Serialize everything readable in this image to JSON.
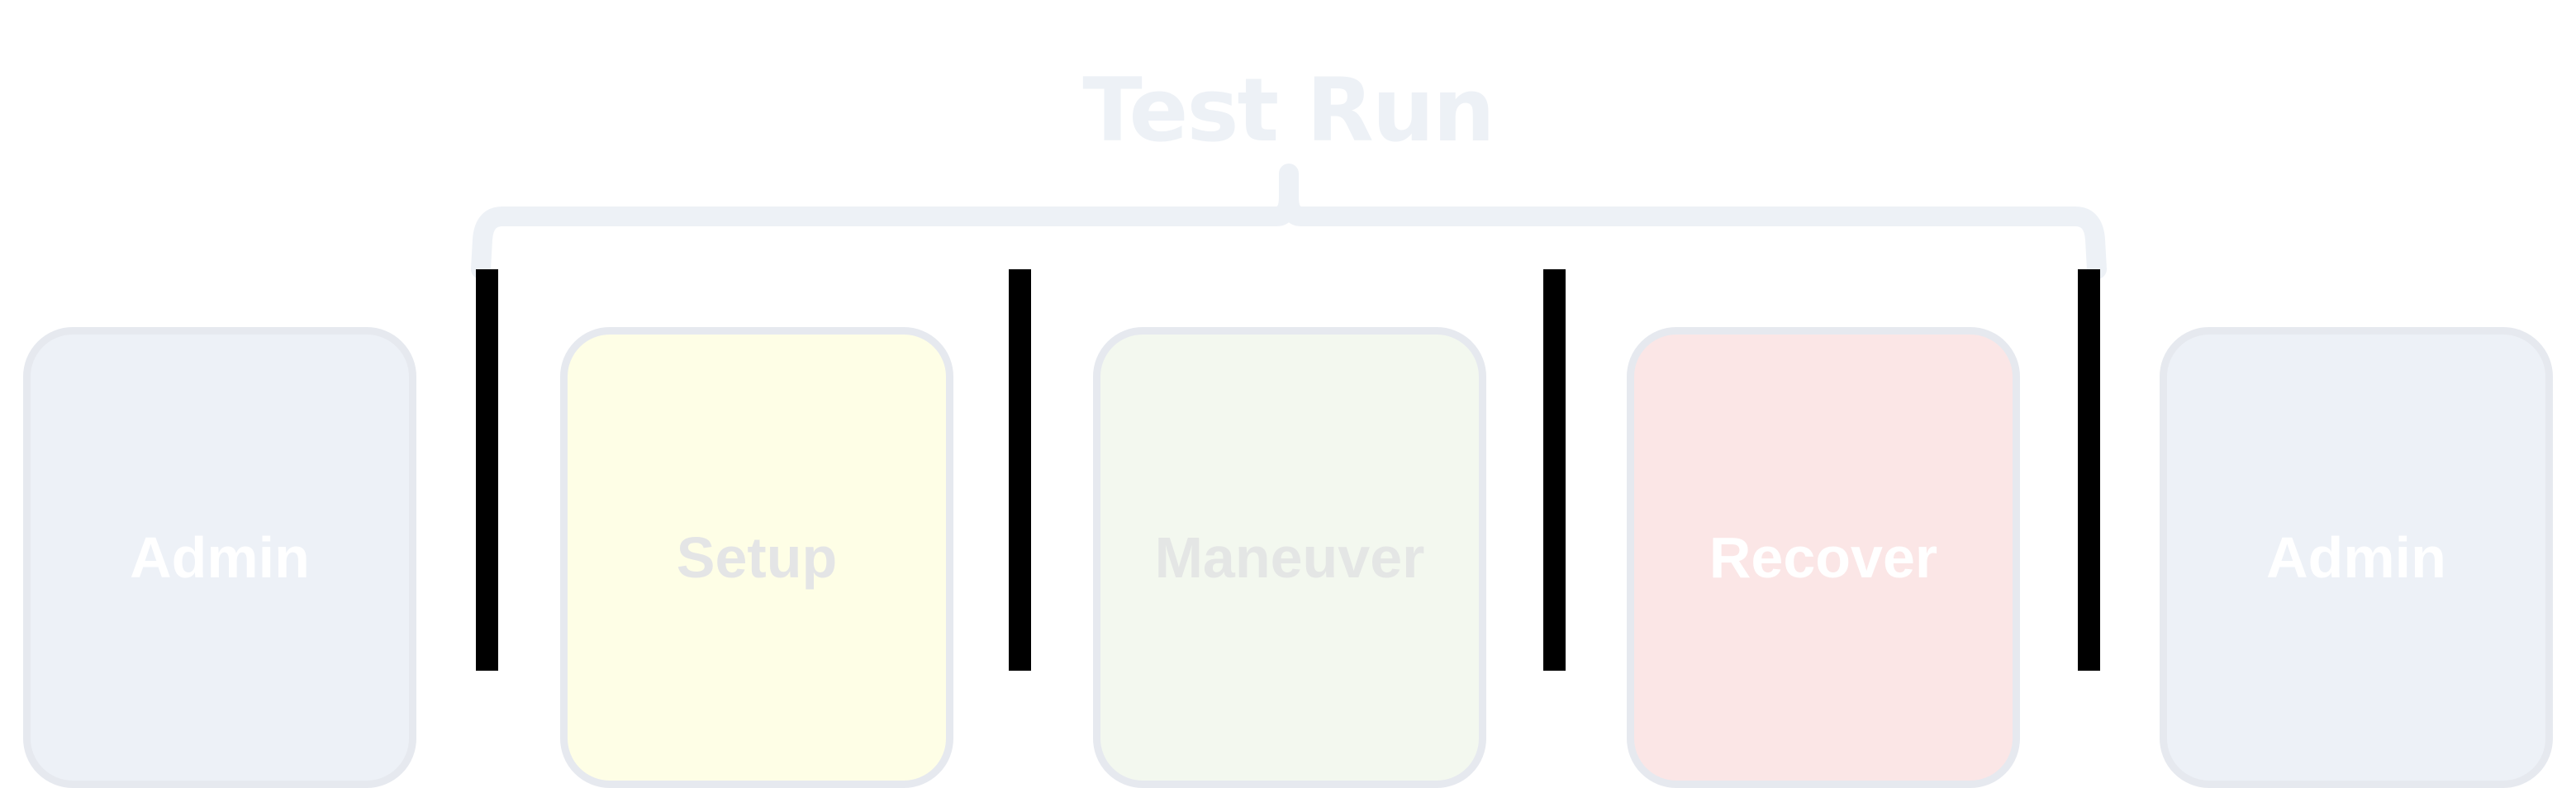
{
  "title": "Test Run",
  "colors": {
    "admin_fill": "#edf1f7",
    "setup_fill": "#fefee6",
    "maneuver_fill": "#f3f8ef",
    "recover_fill": "#fbe6e6",
    "box_border": "#e6e9ef",
    "divider": "#000000",
    "title_and_brace": "#edf1f6"
  },
  "phases": [
    {
      "label": "Admin",
      "fill": "#edf1f7",
      "text_color": "#ffffff"
    },
    {
      "label": "Setup",
      "fill": "#fefee6",
      "text_color": "#e4e5e6"
    },
    {
      "label": "Maneuver",
      "fill": "#f3f8ef",
      "text_color": "#e4e6e5"
    },
    {
      "label": "Recover",
      "fill": "#fbe6e6",
      "text_color": "#ffffff"
    },
    {
      "label": "Admin",
      "fill": "#edf1f7",
      "text_color": "#ffffff"
    }
  ]
}
